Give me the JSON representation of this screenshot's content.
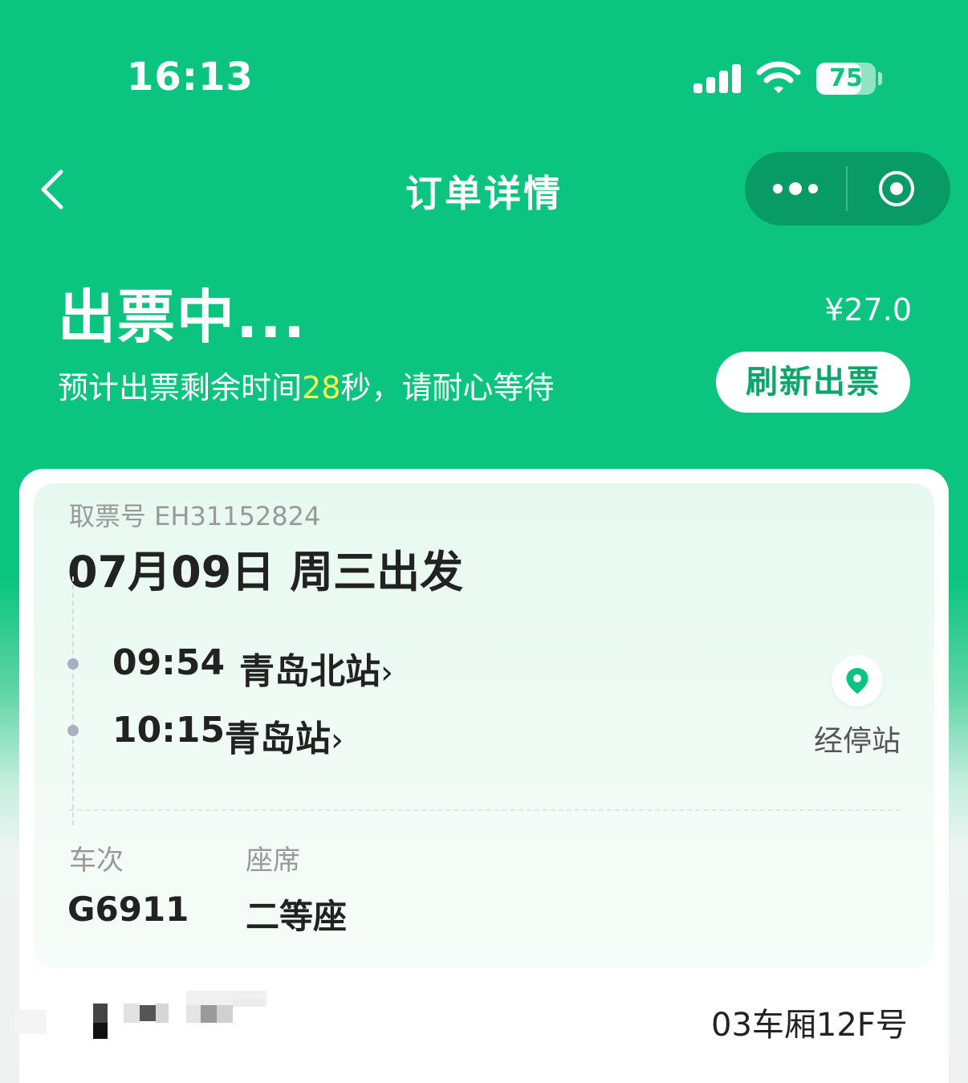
{
  "status_bar": {
    "time": "16:13",
    "battery": "75",
    "battery_level": 0.75
  },
  "nav": {
    "title": "订单详情"
  },
  "order": {
    "status_title": "出票中...",
    "price": "¥27.0",
    "subtitle_prefix": "预计出票剩余时间",
    "seconds": "28",
    "subtitle_suffix": "秒，请耐心等待",
    "refresh_label": "刷新出票"
  },
  "ticket": {
    "ticket_no": "取票号 EH31152824",
    "date": "07月09日 周三出发",
    "depart_time": "09:54",
    "depart_station": "青岛北站",
    "arrive_time": "10:15",
    "arrive_station": "青岛站",
    "stops_label": "经停站",
    "train_label": "车次",
    "train_no": "G6911",
    "seat_label": "座席",
    "seat_class": "二等座",
    "seat_position": "03车厢12F号"
  },
  "colors": {
    "brand": "#0ac47f",
    "highlight": "#f8f64a",
    "button_text": "#0aa66b"
  }
}
